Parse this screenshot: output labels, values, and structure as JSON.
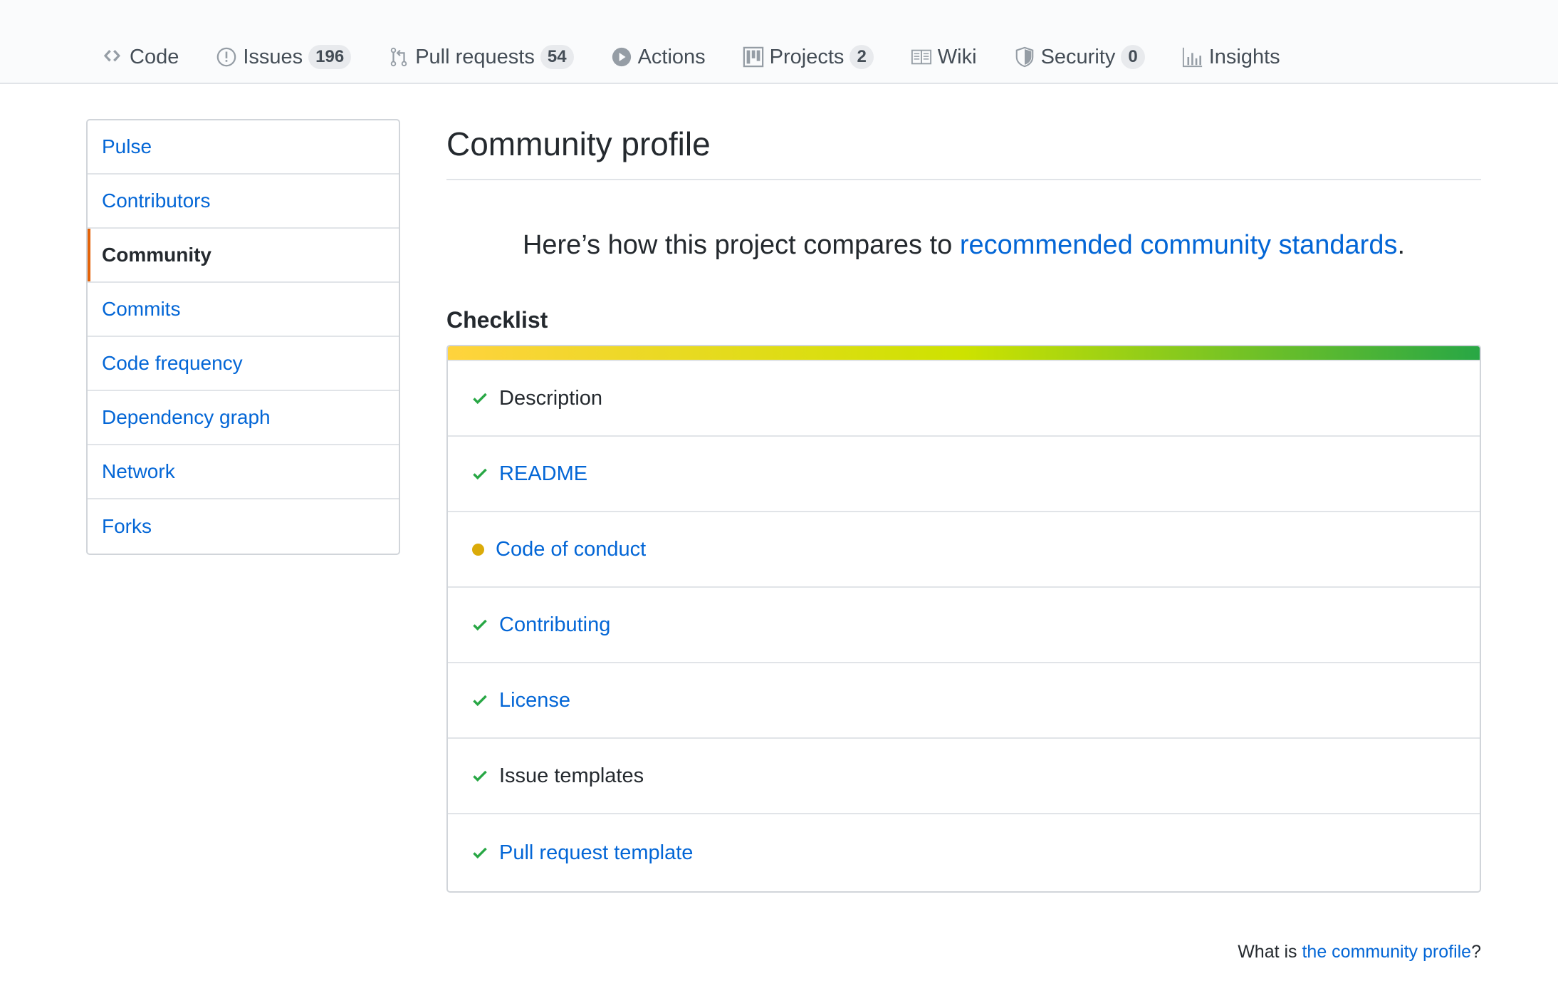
{
  "reponav": {
    "items": [
      {
        "label": "Code",
        "icon": "code-icon"
      },
      {
        "label": "Issues",
        "icon": "issue-icon",
        "count": "196"
      },
      {
        "label": "Pull requests",
        "icon": "pull-request-icon",
        "count": "54"
      },
      {
        "label": "Actions",
        "icon": "play-icon"
      },
      {
        "label": "Projects",
        "icon": "project-icon",
        "count": "2"
      },
      {
        "label": "Wiki",
        "icon": "book-icon"
      },
      {
        "label": "Security",
        "icon": "shield-icon",
        "count": "0"
      },
      {
        "label": "Insights",
        "icon": "graph-icon"
      }
    ]
  },
  "sidebar": {
    "items": [
      {
        "label": "Pulse"
      },
      {
        "label": "Contributors"
      },
      {
        "label": "Community",
        "selected": true
      },
      {
        "label": "Commits"
      },
      {
        "label": "Code frequency"
      },
      {
        "label": "Dependency graph"
      },
      {
        "label": "Network"
      },
      {
        "label": "Forks"
      }
    ],
    "selected_accent": "#e36209"
  },
  "main": {
    "title": "Community profile",
    "subtitle_prefix": "Here’s how this project compares to ",
    "subtitle_link": "recommended community standards",
    "subtitle_suffix": ".",
    "checklist_title": "Checklist",
    "progress_gradient": [
      "#ffd33d",
      "#cde200",
      "#28a745"
    ],
    "checklist": [
      {
        "label": "Description",
        "status": "done",
        "link": false
      },
      {
        "label": "README",
        "status": "done",
        "link": true
      },
      {
        "label": "Code of conduct",
        "status": "missing",
        "link": true
      },
      {
        "label": "Contributing",
        "status": "done",
        "link": true
      },
      {
        "label": "License",
        "status": "done",
        "link": true
      },
      {
        "label": "Issue templates",
        "status": "done",
        "link": false
      },
      {
        "label": "Pull request template",
        "status": "done",
        "link": true
      }
    ],
    "status_colors": {
      "done": "#28a745",
      "missing": "#dbab09"
    }
  },
  "footer": {
    "prefix": "What is ",
    "link": "the community profile",
    "suffix": "?"
  }
}
